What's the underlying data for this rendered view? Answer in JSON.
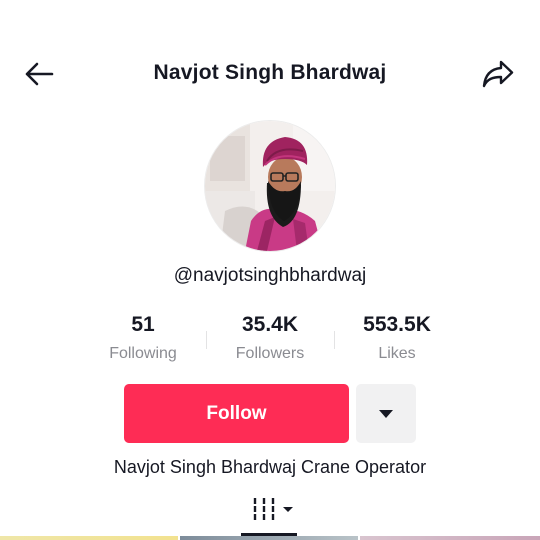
{
  "header": {
    "title": "Navjot Singh Bhardwaj",
    "back_icon": "arrow-left-icon",
    "share_icon": "share-arrow-icon"
  },
  "profile": {
    "username": "@navjotsinghbhardwaj",
    "bio": "Navjot Singh Bhardwaj Crane Operator",
    "avatar_icon": "profile-photo"
  },
  "stats": [
    {
      "value": "51",
      "label": "Following"
    },
    {
      "value": "35.4K",
      "label": "Followers"
    },
    {
      "value": "553.5K",
      "label": "Likes"
    }
  ],
  "actions": {
    "follow_label": "Follow",
    "more_icon": "caret-down-icon"
  },
  "tabs": {
    "grid_icon": "videos-grid-icon",
    "dropdown_icon": "small-caret-down-icon"
  },
  "colors": {
    "accent": "#fe2c55",
    "text": "#161823",
    "secondary_text": "#8a8b91",
    "button_gray": "#f1f1f2"
  }
}
